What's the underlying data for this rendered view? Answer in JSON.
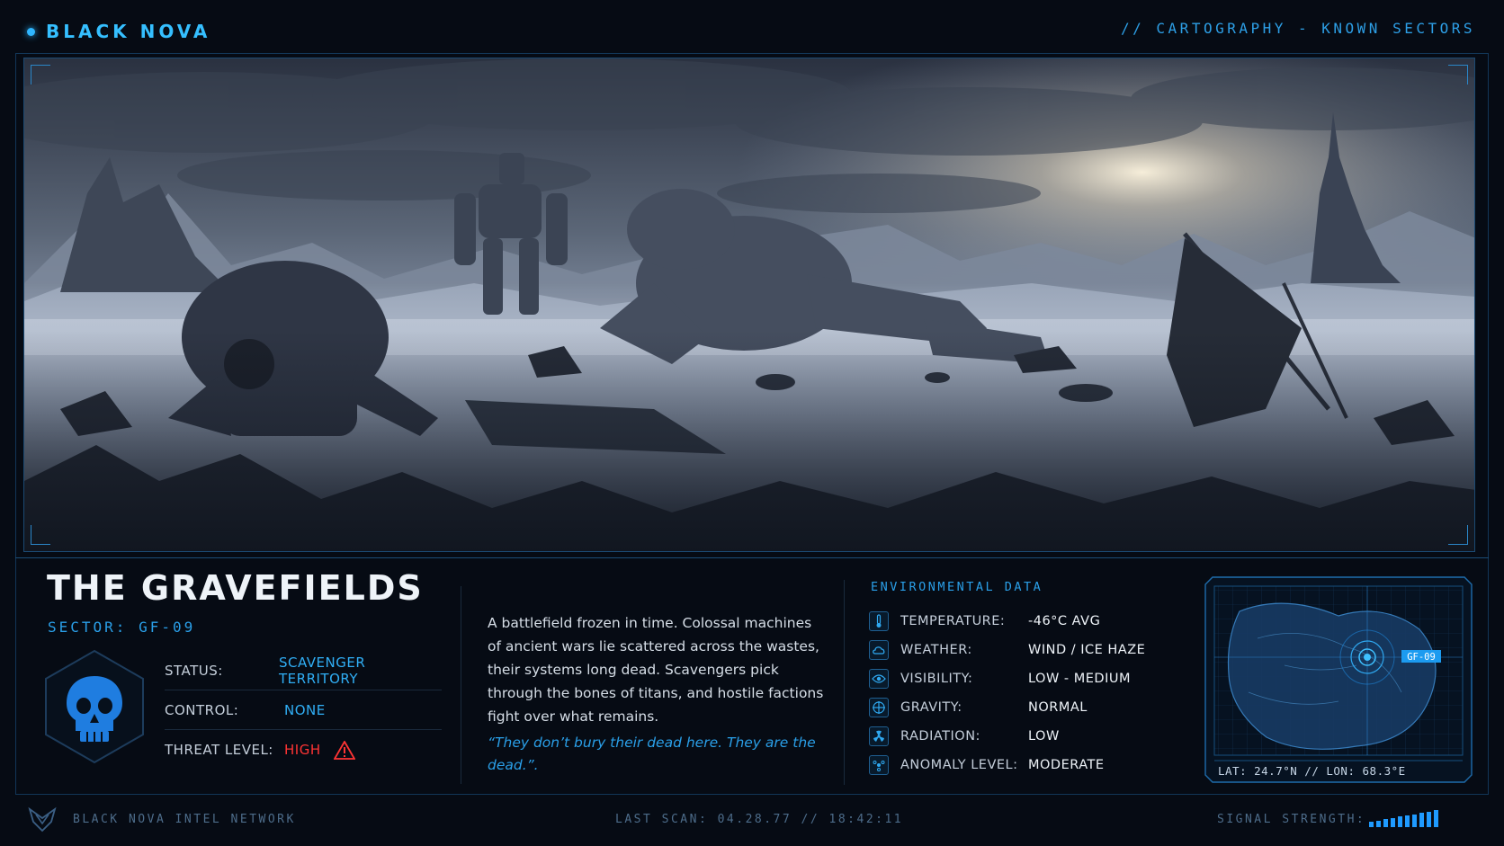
{
  "header": {
    "brand": "BLACK NOVA",
    "breadcrumb": "// CARTOGRAPHY - KNOWN SECTORS"
  },
  "scene": {
    "icon": "landscape-illustration"
  },
  "location": {
    "title": "THE GRAVEFIELDS",
    "sector": "SECTOR: GF-09",
    "emblem_icon": "skull-icon",
    "stats": [
      {
        "label": "STATUS:",
        "value": "SCAVENGER TERRITORY"
      },
      {
        "label": "CONTROL:",
        "value": "NONE"
      },
      {
        "label": "THREAT LEVEL:",
        "value": "HIGH",
        "icon": "warning-icon"
      }
    ],
    "description": "A battlefield frozen in time. Colossal machines of ancient wars lie scattered across the wastes, their systems long dead. Scavengers pick through the bones of titans, and hostile factions fight over what remains.",
    "quote": "“They don’t bury their dead here. They are the dead.”."
  },
  "environment": {
    "title": "ENVIRONMENTAL DATA",
    "rows": [
      {
        "icon": "thermometer-icon",
        "label": "TEMPERATURE:",
        "value": "-46°C AVG"
      },
      {
        "icon": "cloud-icon",
        "label": "WEATHER:",
        "value": "WIND / ICE HAZE"
      },
      {
        "icon": "eye-icon",
        "label": "VISIBILITY:",
        "value": "LOW - MEDIUM"
      },
      {
        "icon": "gravity-icon",
        "label": "GRAVITY:",
        "value": "NORMAL"
      },
      {
        "icon": "radiation-icon",
        "label": "RADIATION:",
        "value": "LOW"
      },
      {
        "icon": "anomaly-icon",
        "label": "ANOMALY LEVEL:",
        "value": "MODERATE"
      }
    ]
  },
  "minimap": {
    "marker_label": "GF-09",
    "coords": "LAT: 24.7°N  // LON: 68.3°E"
  },
  "footer": {
    "network": "BLACK NOVA INTEL NETWORK",
    "last_scan": "LAST SCAN: 04.28.77 // 18:42:11",
    "signal_label": "SIGNAL STRENGTH:",
    "signal_level": 1.0
  },
  "colors": {
    "accent": "#2fb6ff",
    "threat": "#ff3434",
    "background": "#060b14"
  }
}
